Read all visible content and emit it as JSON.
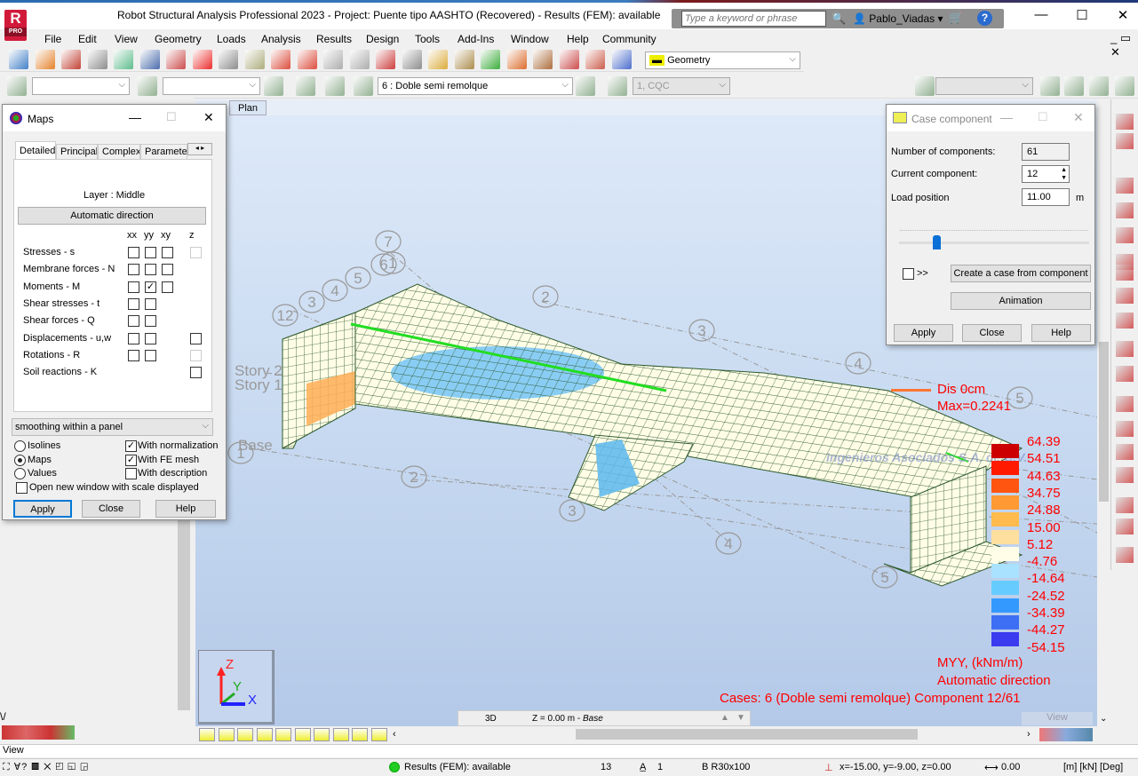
{
  "app": {
    "title": "Robot Structural Analysis Professional 2023 - Project: Puente tipo AASHTO (Recovered) - Results (FEM): available",
    "logo": "R",
    "logo_sub": "PRO",
    "search_placeholder": "Type a keyword or phrase",
    "user": "Pablo_Viadas",
    "brand_color": "#d11a3a"
  },
  "menu": [
    "File",
    "Edit",
    "View",
    "Geometry",
    "Loads",
    "Analysis",
    "Results",
    "Design",
    "Tools",
    "Add-Ins",
    "Window",
    "Help",
    "Community"
  ],
  "toolbar": {
    "layout_select": "Geometry",
    "case_select": "6 : Doble semi remolque",
    "mode_select": "1, CQC"
  },
  "viewport": {
    "tab": "Plan",
    "view_mode": "3D",
    "level": "Z = 0.00 m - ",
    "level_name": "Base",
    "view_label": "View",
    "grid_labels": [
      "7",
      "6",
      "1",
      "5",
      "4",
      "3",
      "12",
      "2",
      "3",
      "4",
      "5",
      "2",
      "3",
      "4",
      "5",
      "1"
    ],
    "story_labels": [
      "Story 2",
      "Story 1",
      "Base"
    ],
    "watermark": "Ingenieros Asociados S.A. de C.V.",
    "axes": {
      "z": "Z",
      "y": "Y",
      "x": "X"
    }
  },
  "legend": {
    "dis_label": "Dis  0cm",
    "max_label": "Max=0.2241",
    "values": [
      "64.39",
      "54.51",
      "44.63",
      "34.75",
      "24.88",
      "15.00",
      "5.12",
      "-4.76",
      "-14.64",
      "-24.52",
      "-34.39",
      "-44.27",
      "-54.15"
    ],
    "colors": [
      "#cc0000",
      "#ff1a00",
      "#ff5511",
      "#ff9933",
      "#ffbb4d",
      "#ffdf9e",
      "#fffde8",
      "#a8e2ff",
      "#66ccff",
      "#3399ff",
      "#3d6ff5",
      "#3b3bf0"
    ],
    "quantity": "MYY, (kNm/m)",
    "direction": "Automatic direction",
    "cases": "Cases: 6 (Doble semi remolque) Component 12/61"
  },
  "maps": {
    "title": "Maps",
    "tabs": [
      "Detailed",
      "Principal",
      "Complex",
      "Parameter"
    ],
    "layer": "Layer : Middle",
    "auto_dir": "Automatic direction",
    "cols": [
      "xx",
      "yy",
      "xy",
      "z"
    ],
    "rows": [
      {
        "label": "Stresses - s",
        "xx": false,
        "yy": false,
        "xy": false,
        "z": "disabled"
      },
      {
        "label": "Membrane forces - N",
        "xx": false,
        "yy": false,
        "xy": false
      },
      {
        "label": "Moments - M",
        "xx": false,
        "yy": true,
        "xy": false
      },
      {
        "label": "Shear stresses - t",
        "xx": false,
        "yy": false
      },
      {
        "label": "Shear forces - Q",
        "xx": false,
        "yy": false
      },
      {
        "label": "Displacements - u,w",
        "xx": false,
        "yy": false,
        "z": false
      },
      {
        "label": "Rotations - R",
        "xx": false,
        "yy": false,
        "z": "disabled"
      },
      {
        "label": "Soil reactions - K",
        "z": false
      }
    ],
    "smoothing": "smoothing within a panel",
    "radios": [
      {
        "label": "Isolines",
        "on": false
      },
      {
        "label": "Maps",
        "on": true
      },
      {
        "label": "Values",
        "on": false
      }
    ],
    "checks": [
      {
        "label": "With normalization",
        "on": true
      },
      {
        "label": "With FE mesh",
        "on": true
      },
      {
        "label": "With description",
        "on": false
      }
    ],
    "open_new": "Open new window with scale displayed",
    "apply": "Apply",
    "close": "Close",
    "help": "Help"
  },
  "case_component": {
    "title": "Case component",
    "num_label": "Number of components:",
    "num": "61",
    "cur_label": "Current component:",
    "cur": "12",
    "pos_label": "Load position",
    "pos": "11.00",
    "unit": "m",
    "slider_fraction": 0.183,
    "next_label": ">>",
    "create": "Create a case from component",
    "animation": "Animation",
    "apply": "Apply",
    "close": "Close",
    "help": "Help"
  },
  "status": {
    "view": "View",
    "results": "Results (FEM): available",
    "results_color": "#22cc22",
    "num1": "13",
    "num2": "1",
    "section": "B R30x100",
    "coords": "x=-15.00, y=-9.00, z=0.00",
    "angle": "0.00",
    "units": "[m] [kN] [Deg]"
  }
}
